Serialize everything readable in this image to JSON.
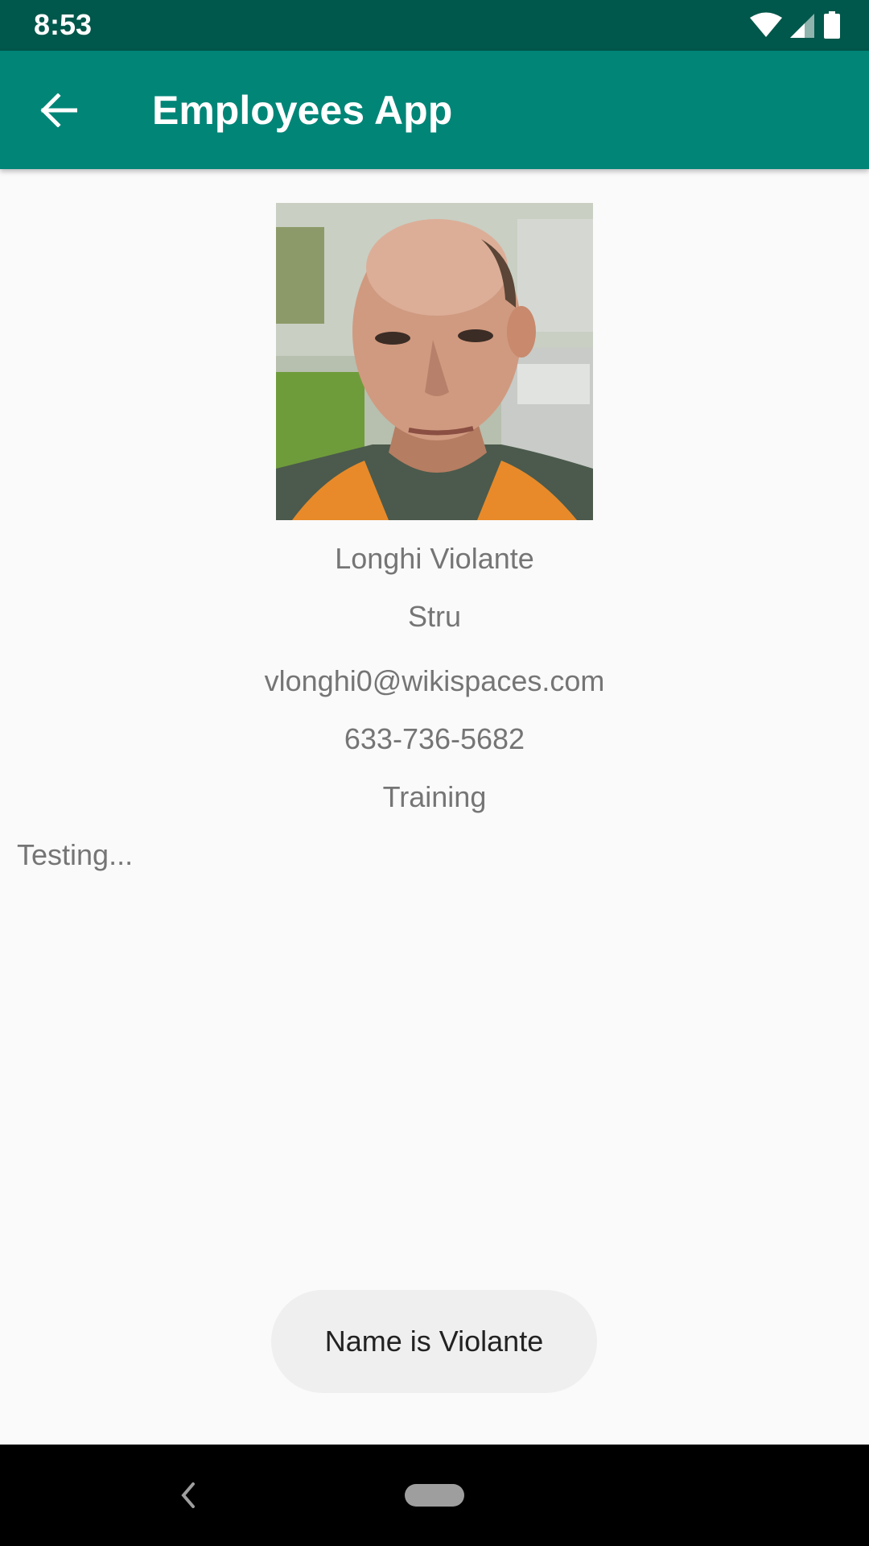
{
  "status_bar": {
    "time": "8:53",
    "icons": [
      "wifi-icon",
      "cell-signal-icon",
      "battery-icon"
    ]
  },
  "app_bar": {
    "title": "Employees App",
    "back_icon": "arrow-back-icon"
  },
  "employee": {
    "name": "Longhi Violante",
    "role": "Stru",
    "email": "vlonghi0@wikispaces.com",
    "phone": "633-736-5682",
    "department": "Training"
  },
  "status_text": "Testing...",
  "toast": {
    "message": "Name is Violante"
  },
  "nav_bar": {
    "back_icon": "nav-back-icon",
    "home_icon": "nav-home-pill-icon"
  },
  "colors": {
    "status_bar": "#00574b",
    "app_bar": "#008577",
    "background": "#fafafa",
    "text_secondary": "#757575",
    "toast_bg": "#efefef"
  }
}
